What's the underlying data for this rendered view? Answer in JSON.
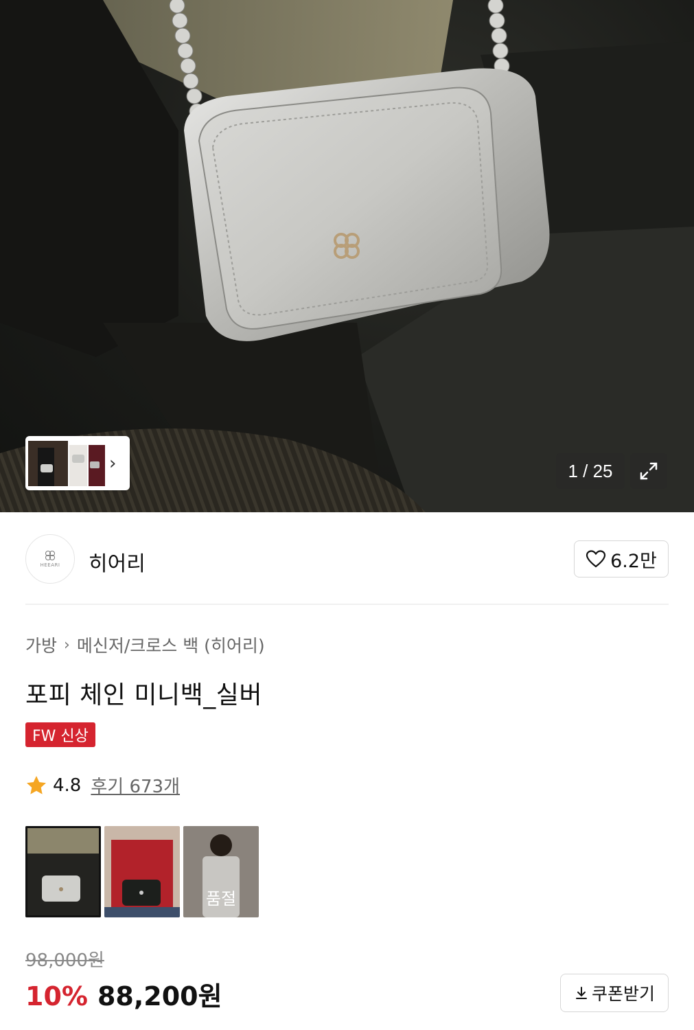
{
  "gallery": {
    "counter": "1 / 25",
    "thumbnail_count_icon": "chevron-right-icon"
  },
  "brand": {
    "name": "히어리",
    "logo_text": "HEEARI",
    "likes": "6.2만"
  },
  "breadcrumb": {
    "category": "가방",
    "subcategory": "메신저/크로스 백 (히어리)"
  },
  "product": {
    "title": "포피 체인 미니백_실버",
    "badge": "FW 신상",
    "rating": "4.8",
    "reviews": "후기 673개"
  },
  "options": [
    {
      "label": "",
      "selected": true,
      "soldout": false
    },
    {
      "label": "",
      "selected": false,
      "soldout": false
    },
    {
      "label": "품절",
      "selected": false,
      "soldout": true
    }
  ],
  "price": {
    "original": "98,000원",
    "discount": "10%",
    "final": "88,200원"
  },
  "coupon": {
    "label": "쿠폰받기"
  },
  "colors": {
    "accent": "#d5242f",
    "star": "#f5a623"
  }
}
